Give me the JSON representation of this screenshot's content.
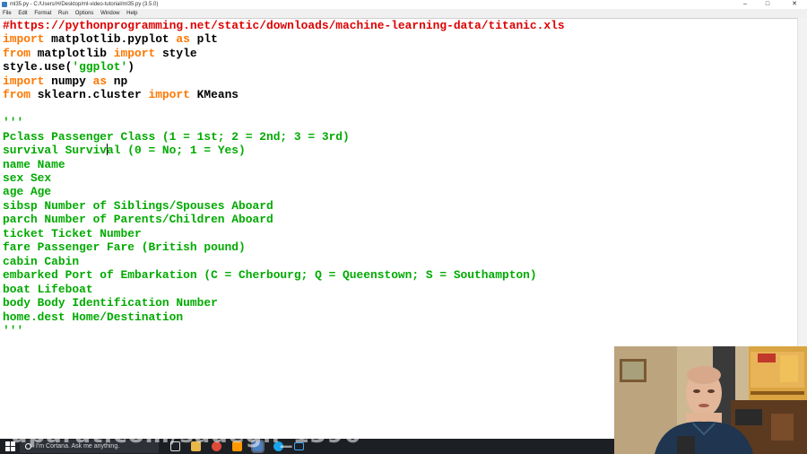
{
  "window": {
    "title": "ml35.py - C:/Users/H/Desktop/ml-video-tutorial/ml35.py (3.5.0)",
    "minimize": "–",
    "maximize": "□",
    "close": "✕"
  },
  "menu": [
    "File",
    "Edit",
    "Format",
    "Run",
    "Options",
    "Window",
    "Help"
  ],
  "code": {
    "l1": "#https://pythonprogramming.net/static/downloads/machine-learning-data/titanic.xls",
    "l2_kw": "import",
    "l2_mid": " matplotlib.pyplot ",
    "l2_kw2": "as",
    "l2_end": " plt",
    "l3_kw": "from",
    "l3_mid": " matplotlib ",
    "l3_kw2": "import",
    "l3_end": " style",
    "l4_a": "style.use(",
    "l4_str": "'ggplot'",
    "l4_b": ")",
    "l5_kw": "import",
    "l5_mid": " numpy ",
    "l5_kw2": "as",
    "l5_end": " np",
    "l6_kw": "from",
    "l6_mid": " sklearn.cluster ",
    "l6_kw2": "import",
    "l6_end": " KMeans",
    "doc_open": "'''",
    "doc_1": "Pclass Passenger Class (1 = 1st; 2 = 2nd; 3 = 3rd)",
    "doc_2a": "survival Surviv",
    "doc_2b": "al (0 = No; 1 = Yes)",
    "doc_3": "name Name",
    "doc_4": "sex Sex",
    "doc_5": "age Age",
    "doc_6": "sibsp Number of Siblings/Spouses Aboard",
    "doc_7": "parch Number of Parents/Children Aboard",
    "doc_8": "ticket Ticket Number",
    "doc_9": "fare Passenger Fare (British pound)",
    "doc_10": "cabin Cabin",
    "doc_11": "embarked Port of Embarkation (C = Cherbourg; Q = Queenstown; S = Southampton)",
    "doc_12": "boat Lifeboat",
    "doc_13": "body Body Identification Number",
    "doc_14": "home.dest Home/Destination",
    "doc_close": "'''"
  },
  "taskbar": {
    "cortana_text": "I'm Cortana. Ask me anything.",
    "icons": [
      "task-view-icon",
      "file-explorer-icon",
      "chrome-icon",
      "sublime-icon",
      "python-idle-icon",
      "skype-icon",
      "monitor-icon"
    ]
  },
  "watermark": "uparat.com/sadegh_1396",
  "colors": {
    "comment": "#dd0000",
    "keyword": "#ff7700",
    "string": "#00aa00",
    "default": "#000000",
    "taskbar": "#1c1f24"
  }
}
